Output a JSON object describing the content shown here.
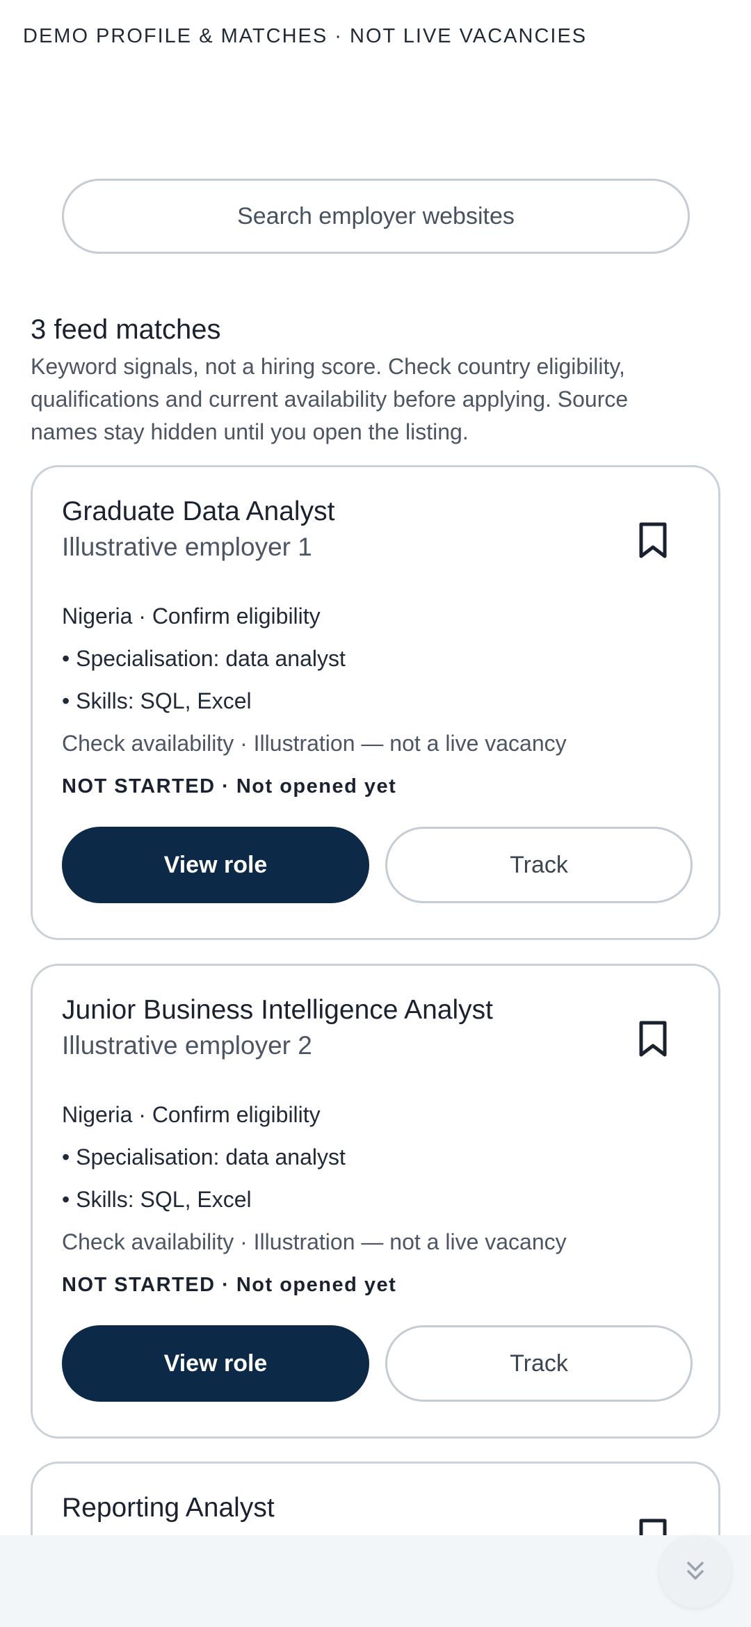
{
  "banner": {
    "text": "DEMO PROFILE & MATCHES · NOT LIVE VACANCIES"
  },
  "search": {
    "label": "Search employer websites"
  },
  "results": {
    "title": "3 feed matches",
    "description": "Keyword signals, not a hiring score. Check country eligibility, qualifications and current availability before applying. Source names stay hidden until you open the listing."
  },
  "cards": [
    {
      "title": "Graduate Data Analyst",
      "employer": "Illustrative employer 1",
      "location": "Nigeria · Confirm eligibility",
      "specialisation": "• Specialisation: data analyst",
      "skills": "• Skills: SQL, Excel",
      "availability": "Check availability · Illustration — not a live vacancy",
      "status": "NOT STARTED · Not opened yet",
      "view_label": "View role",
      "track_label": "Track"
    },
    {
      "title": "Junior Business Intelligence Analyst",
      "employer": "Illustrative employer 2",
      "location": "Nigeria · Confirm eligibility",
      "specialisation": "• Specialisation: data analyst",
      "skills": "• Skills: SQL, Excel",
      "availability": "Check availability · Illustration — not a live vacancy",
      "status": "NOT STARTED · Not opened yet",
      "view_label": "View role",
      "track_label": "Track"
    },
    {
      "title": "Reporting Analyst"
    }
  ],
  "icons": {
    "bookmark": "bookmark-icon",
    "scroll": "double-chevron-down-icon"
  },
  "colors": {
    "primary": "#0c2948",
    "border": "#c9d1d9",
    "text": "#1a2230",
    "muted": "#4b5563"
  }
}
